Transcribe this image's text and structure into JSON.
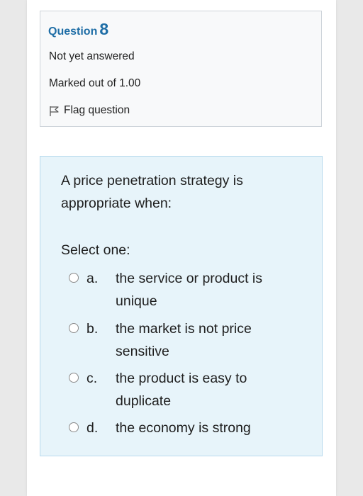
{
  "info": {
    "question_label": "Question",
    "question_number": "8",
    "status": "Not yet answered",
    "marks": "Marked out of 1.00",
    "flag_label": "Flag question"
  },
  "question": {
    "text": "A price penetration strategy is appropriate when:",
    "prompt": "Select one:",
    "options": [
      {
        "letter": "a.",
        "text": "the service or product is unique",
        "selected": false
      },
      {
        "letter": "b.",
        "text": "the market is not price sensitive",
        "selected": false
      },
      {
        "letter": "c.",
        "text": "the product is easy to duplicate",
        "selected": false
      },
      {
        "letter": "d.",
        "text": "the economy is strong",
        "selected": false
      }
    ]
  },
  "colors": {
    "accent": "#1f6ea6",
    "content_bg": "#e7f4fa",
    "info_bg": "#f8f9fa"
  }
}
